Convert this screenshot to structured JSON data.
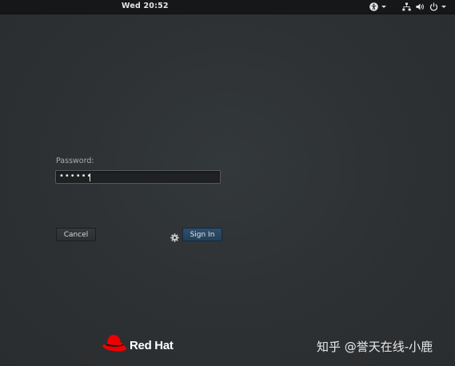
{
  "topbar": {
    "clock": "Wed 20:52",
    "icons": [
      "accessibility-icon",
      "network-icon",
      "volume-icon",
      "power-icon"
    ]
  },
  "login": {
    "password_label": "Password:",
    "password_value": "••••••",
    "cancel_label": "Cancel",
    "signin_label": "Sign In"
  },
  "branding": {
    "logo_text": "Red Hat",
    "logo_color": "#ee0000"
  },
  "watermark": "知乎 @誉天在线-小鹿",
  "colors": {
    "background": "#2e3133",
    "topbar": "#161718",
    "signin_button": "#2a4862"
  }
}
